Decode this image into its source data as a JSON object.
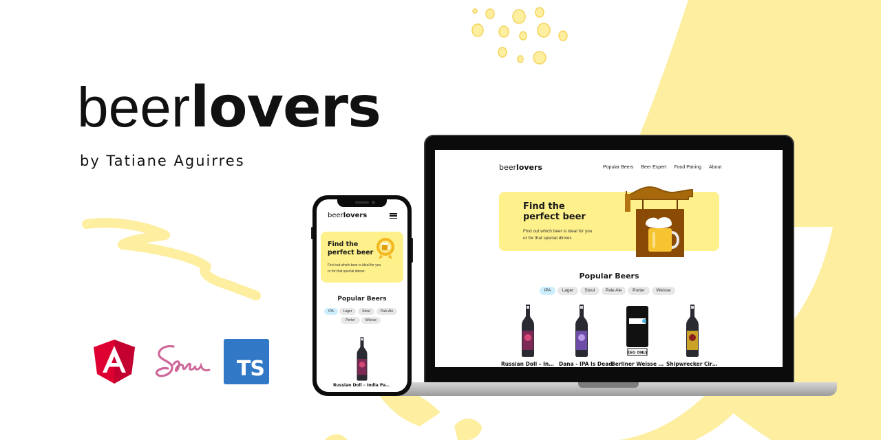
{
  "brand": {
    "light": "beer",
    "bold": "lovers",
    "byline": "by Tatiane Aguirres"
  },
  "tech_logos": [
    {
      "name": "angular-icon",
      "color": "#dd0031"
    },
    {
      "name": "sass-icon",
      "color": "#cd6799"
    },
    {
      "name": "typescript-icon",
      "label": "TS",
      "color": "#3178c6"
    }
  ],
  "colors": {
    "accent_yellow": "#fef08a",
    "background_yellow": "#fdeea0",
    "chip_active": "#cdeffd",
    "chip": "#e8e8e8"
  },
  "laptop": {
    "logo": {
      "light": "beer",
      "bold": "lovers"
    },
    "nav": [
      "Popular Beers",
      "Beer Expert",
      "Food Pairing",
      "About"
    ],
    "hero": {
      "title": "Find the\nperfect beer",
      "text": "Find out which beer is ideal for you\nor for that special dinner."
    },
    "section_title": "Popular Beers",
    "filters": [
      "IPA",
      "Lager",
      "Stout",
      "Pale Ale",
      "Porter",
      "Weisse"
    ],
    "active_filter": "IPA",
    "beers": [
      "Russian Doll – India Pale Ale",
      "Dana - IPA Is Dead",
      "Berliner Weisse With Yuzu",
      "Shipwrecker Circus"
    ],
    "keg_label": "KEG ONLY"
  },
  "phone": {
    "logo": {
      "light": "beer",
      "bold": "lovers"
    },
    "menu_icon": "hamburger-menu-icon",
    "hero": {
      "title": "Find the\nperfect beer",
      "text": "Find out which beer is ideal for you\nor for that special dinner."
    },
    "section_title": "Popular Beers",
    "filters": [
      "IPA",
      "Lager",
      "Stout",
      "Pale Ale",
      "Porter",
      "Weisse"
    ],
    "active_filter": "IPA",
    "beers": [
      "Russian Doll – India Pale Ale"
    ]
  }
}
